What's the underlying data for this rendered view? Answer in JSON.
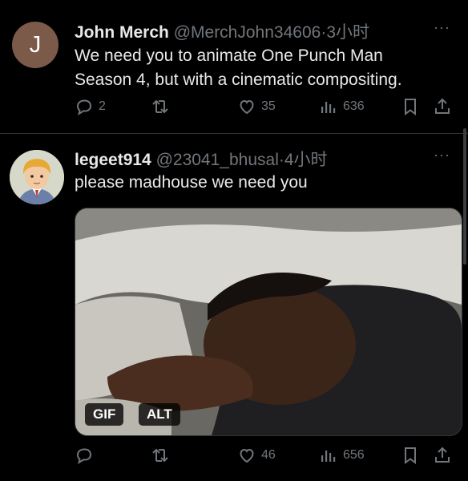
{
  "tweets": [
    {
      "avatar_letter": "J",
      "avatar_color": "#7b5a4a",
      "display_name": "John Merch",
      "handle": "@MerchJohn34606",
      "sep": "·",
      "time": "3小时",
      "text_line1": "We need you to animate One Punch Man",
      "text_line2": "Season 4, but with a cinematic compositing.",
      "more": "···",
      "replies": "2",
      "retweets": "",
      "likes": "35",
      "views": "636"
    },
    {
      "display_name": "legeet914",
      "handle": "@23041_bhusal",
      "sep": "·",
      "time": "4小时",
      "text": "please madhouse we need you",
      "more": "···",
      "media": {
        "gif_label": "GIF",
        "alt_label": "ALT"
      },
      "replies": "",
      "retweets": "",
      "likes": "46",
      "views": "656"
    }
  ],
  "colors": {
    "background": "#000000",
    "text": "#e7e9ea",
    "muted": "#71767b",
    "divider": "#2f3336"
  }
}
